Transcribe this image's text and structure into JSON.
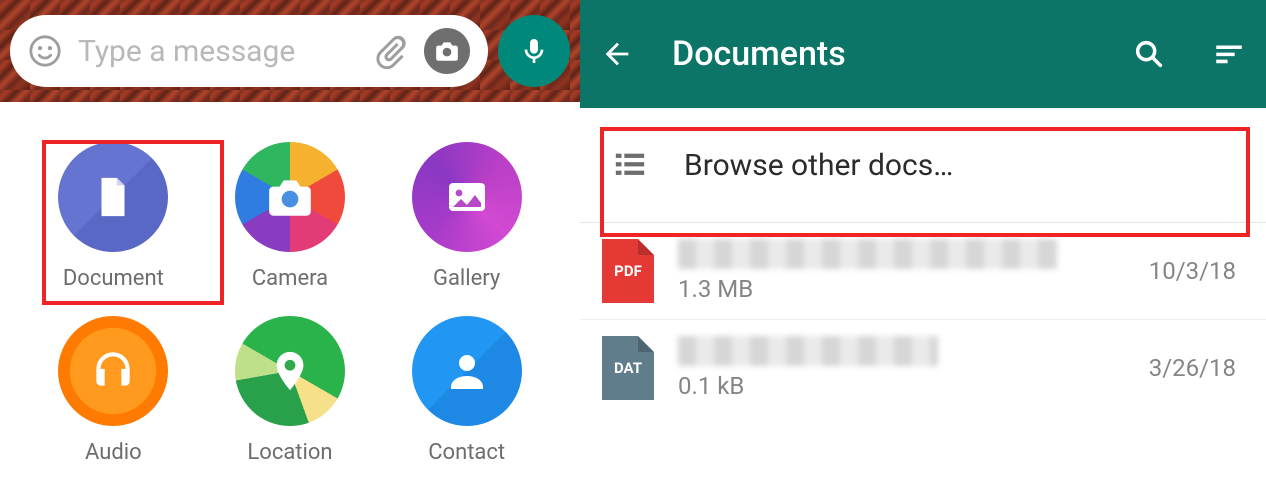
{
  "left": {
    "input_placeholder": "Type a message",
    "attachments": [
      {
        "label": "Document",
        "name": "attachment-document"
      },
      {
        "label": "Camera",
        "name": "attachment-camera"
      },
      {
        "label": "Gallery",
        "name": "attachment-gallery"
      },
      {
        "label": "Audio",
        "name": "attachment-audio"
      },
      {
        "label": "Location",
        "name": "attachment-location"
      },
      {
        "label": "Contact",
        "name": "attachment-contact"
      }
    ]
  },
  "right": {
    "title": "Documents",
    "browse_label": "Browse other docs…",
    "files": [
      {
        "type": "PDF",
        "size": "1.3 MB",
        "date": "10/3/18"
      },
      {
        "type": "DAT",
        "size": "0.1 kB",
        "date": "3/26/18"
      }
    ]
  }
}
